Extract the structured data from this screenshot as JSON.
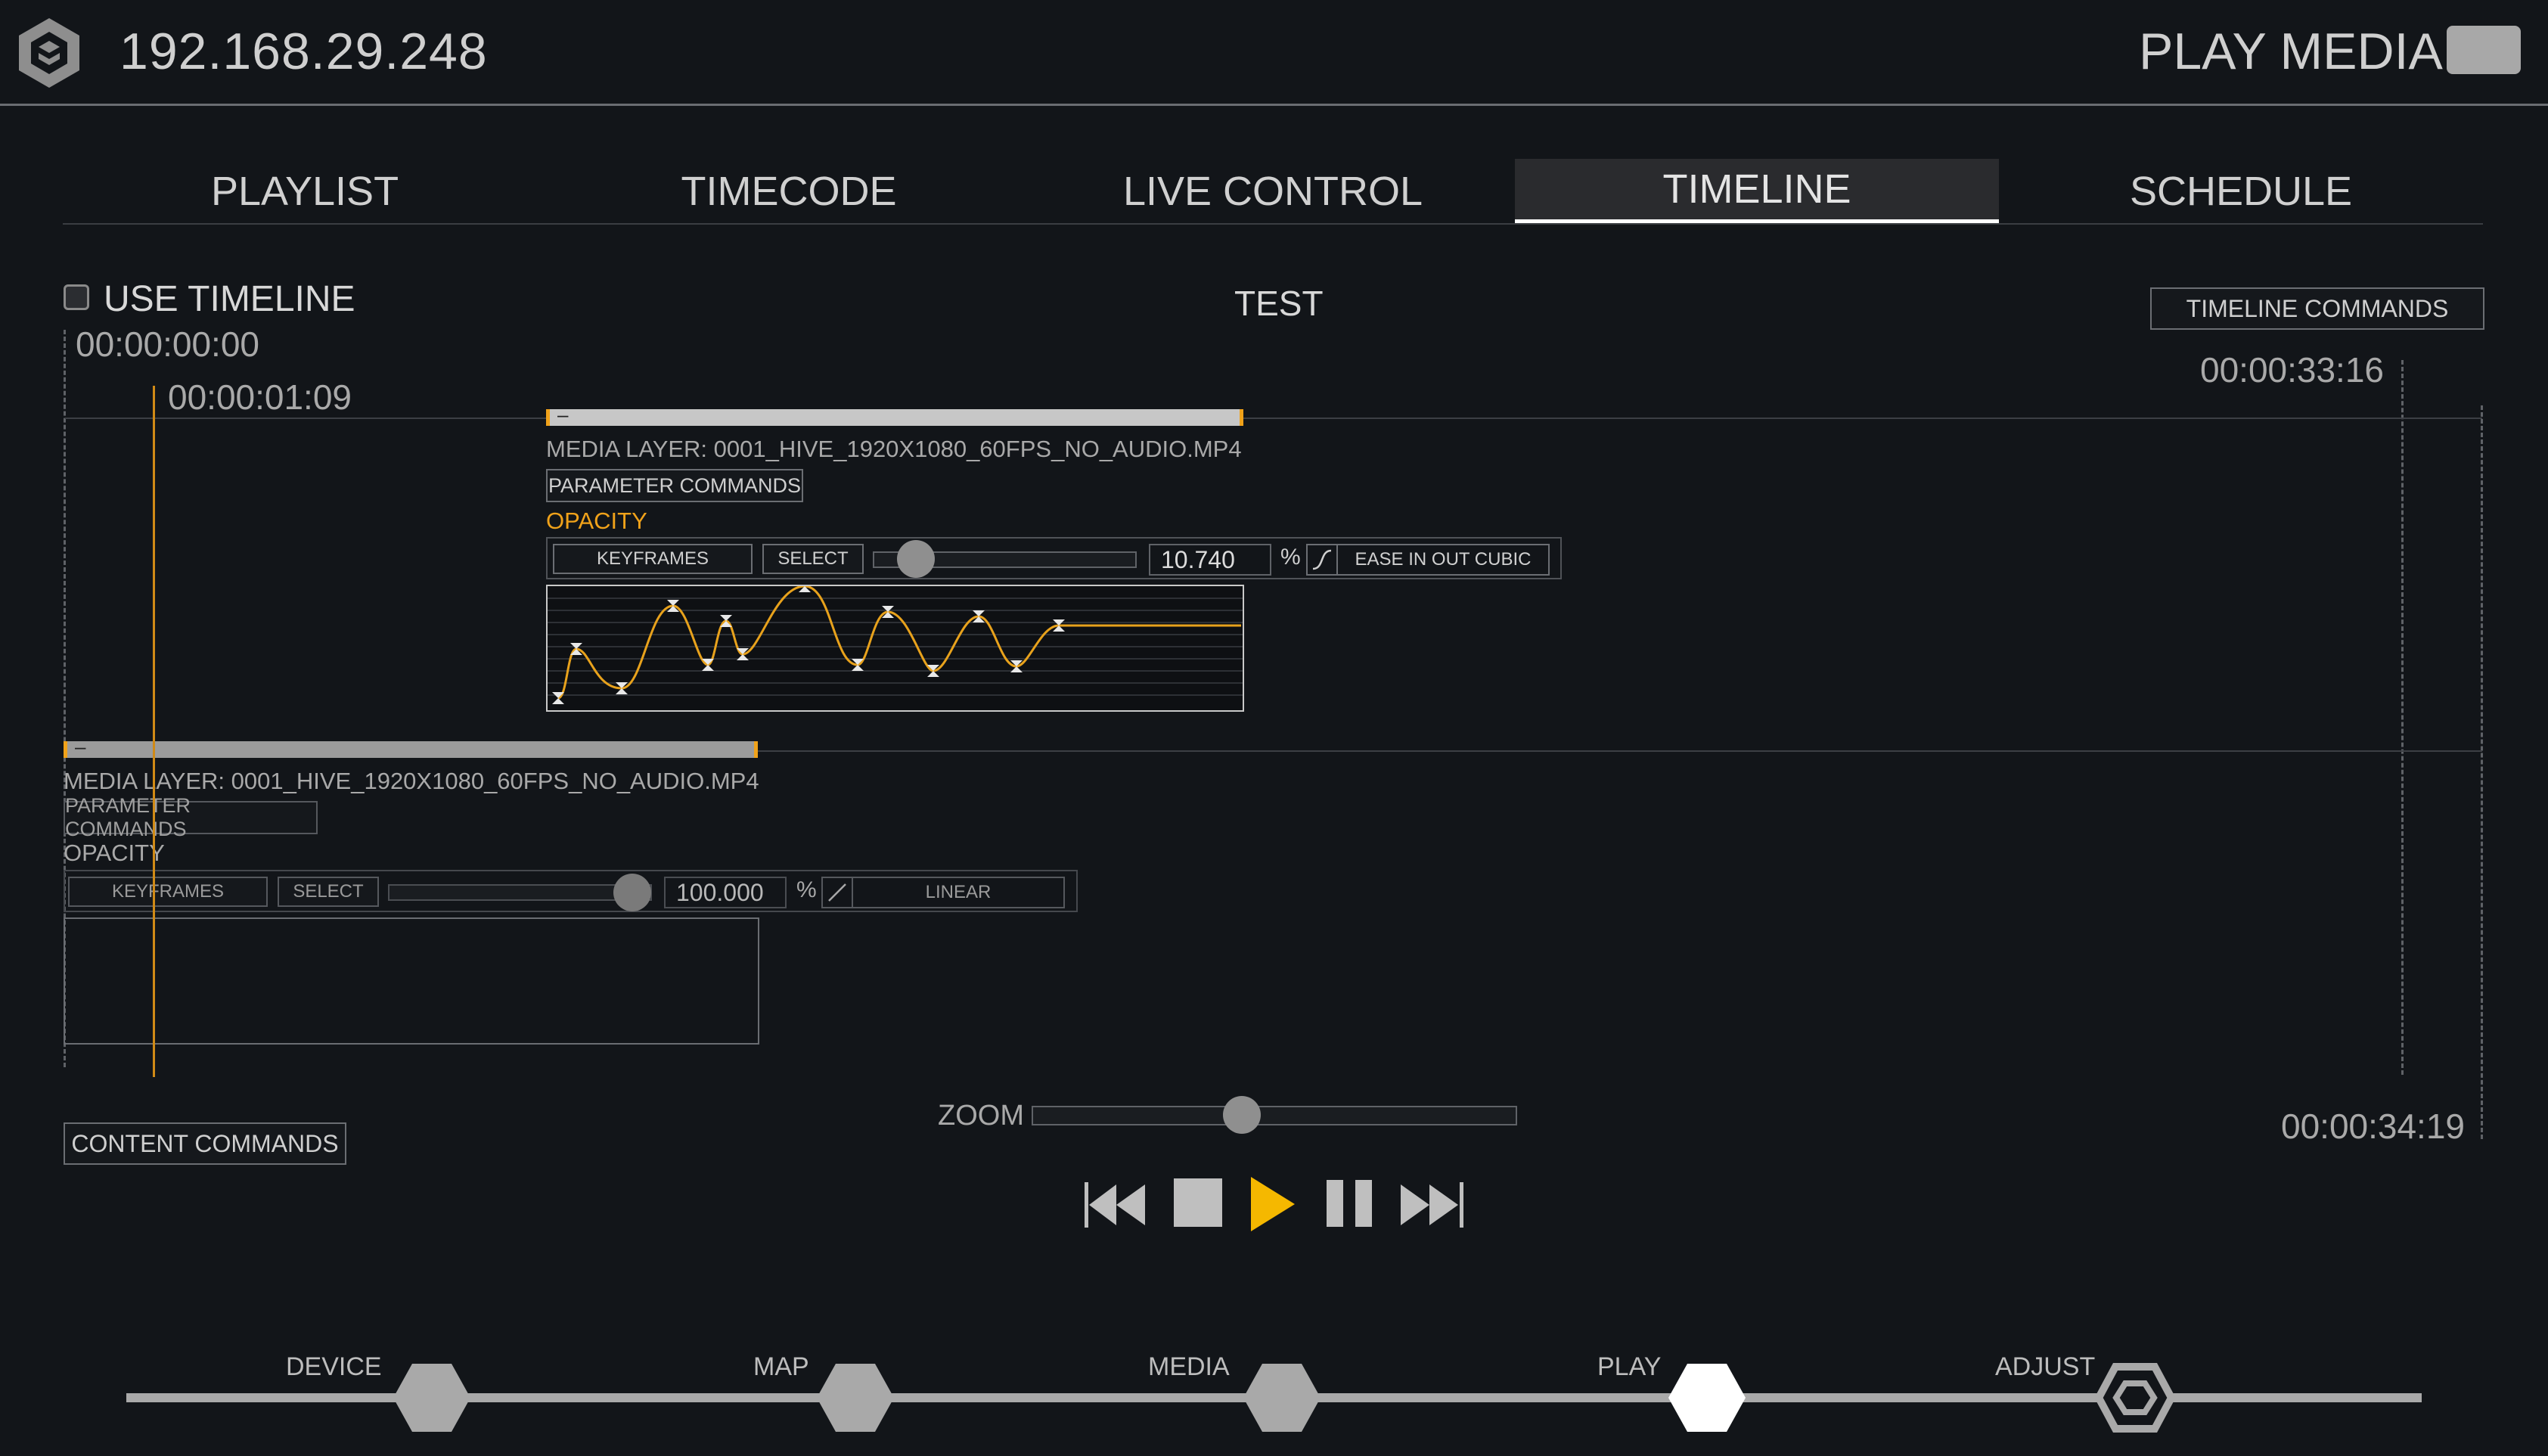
{
  "header": {
    "ip": "192.168.29.248",
    "mode_label": "PLAY MEDIA"
  },
  "tabs": [
    {
      "label": "PLAYLIST",
      "active": false
    },
    {
      "label": "TIMECODE",
      "active": false
    },
    {
      "label": "LIVE CONTROL",
      "active": false
    },
    {
      "label": "TIMELINE",
      "active": true
    },
    {
      "label": "SCHEDULE",
      "active": false
    }
  ],
  "timeline": {
    "use_timeline_label": "USE TIMELINE",
    "use_timeline_checked": false,
    "name": "TEST",
    "commands_label": "TIMELINE COMMANDS",
    "start_time": "00:00:00:00",
    "playhead_time": "00:00:01:09",
    "end_marker_time": "00:00:33:16",
    "total_time": "00:00:34:19",
    "content_commands_label": "CONTENT COMMANDS",
    "zoom_label": "ZOOM",
    "zoom_level": 0.43
  },
  "layers": [
    {
      "title": "MEDIA LAYER: 0001_HIVE_1920X1080_60FPS_NO_AUDIO.MP4",
      "bar_symbol": "–",
      "param_commands_label": "PARAMETER COMMANDS",
      "parameter": "OPACITY",
      "keyframes_label": "KEYFRAMES",
      "select_label": "SELECT",
      "value": "10.740",
      "value_fraction": 0.107,
      "unit": "%",
      "easing": "EASE IN OUT CUBIC"
    },
    {
      "title": "MEDIA LAYER: 0001_HIVE_1920X1080_60FPS_NO_AUDIO.MP4",
      "bar_symbol": "–",
      "param_commands_label": "PARAMETER COMMANDS",
      "parameter": "OPACITY",
      "keyframes_label": "KEYFRAMES",
      "select_label": "SELECT",
      "value": "100.000",
      "value_fraction": 1.0,
      "unit": "%",
      "easing": "LINEAR"
    }
  ],
  "transport": {
    "prev": "skip-back-icon",
    "stop": "stop-icon",
    "play": "play-icon",
    "pause": "pause-icon",
    "next": "skip-forward-icon",
    "play_color": "#f5b800"
  },
  "nav": [
    {
      "label": "DEVICE",
      "active": false
    },
    {
      "label": "MAP",
      "active": false
    },
    {
      "label": "MEDIA",
      "active": false
    },
    {
      "label": "PLAY",
      "active": true
    },
    {
      "label": "ADJUST",
      "active": false
    }
  ],
  "colors": {
    "background": "#121519",
    "accent": "#f0a21a",
    "text": "#d4d4d4"
  }
}
